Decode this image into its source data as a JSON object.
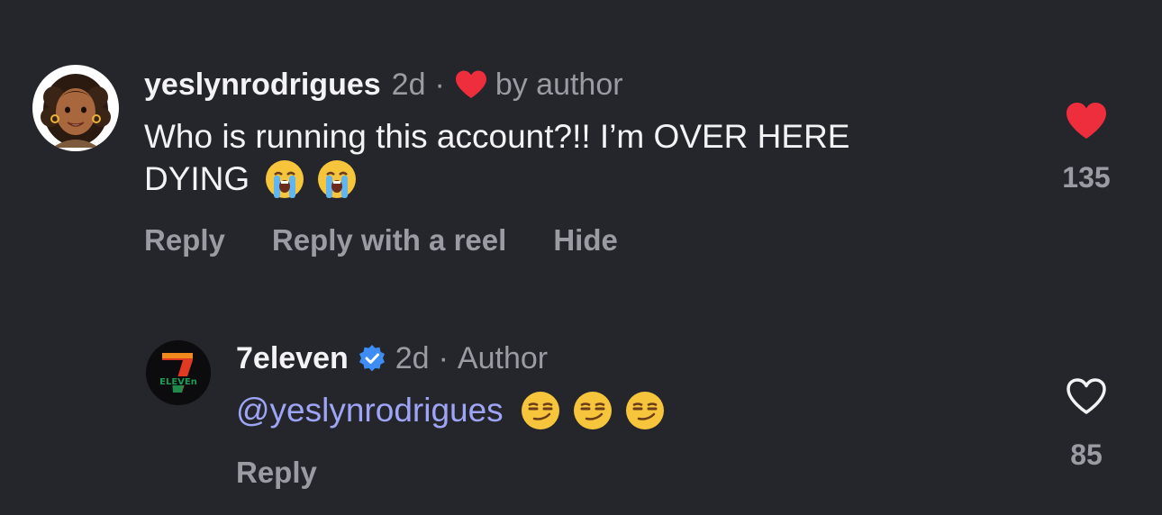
{
  "colors": {
    "background": "#25262c",
    "text_primary": "#f3f3f5",
    "text_secondary": "#9a9ca3",
    "mention": "#9ea4f6",
    "heart_red": "#ee2e3d",
    "verified_blue": "#3d8df5"
  },
  "comments": [
    {
      "username": "yeslynrodrigues",
      "time": "2d",
      "separator": "·",
      "author_like_label": "by author",
      "text_line1": "Who is running this account?!! I’m OVER HERE",
      "text_line2": "DYING",
      "emojis": [
        "loudly-crying-face",
        "loudly-crying-face"
      ],
      "actions": {
        "reply": "Reply",
        "reply_reel": "Reply with a reel",
        "hide": "Hide"
      },
      "like_icon": "heart-filled-icon",
      "like_count": "135"
    },
    {
      "username": "7eleven",
      "verified_icon": "verified-badge-icon",
      "time": "2d",
      "separator": "·",
      "role": "Author",
      "mention": "@yeslynrodrigues",
      "emojis": [
        "smirking-face",
        "smirking-face",
        "smirking-face"
      ],
      "actions": {
        "reply": "Reply"
      },
      "like_icon": "heart-outline-icon",
      "like_count": "85"
    }
  ]
}
